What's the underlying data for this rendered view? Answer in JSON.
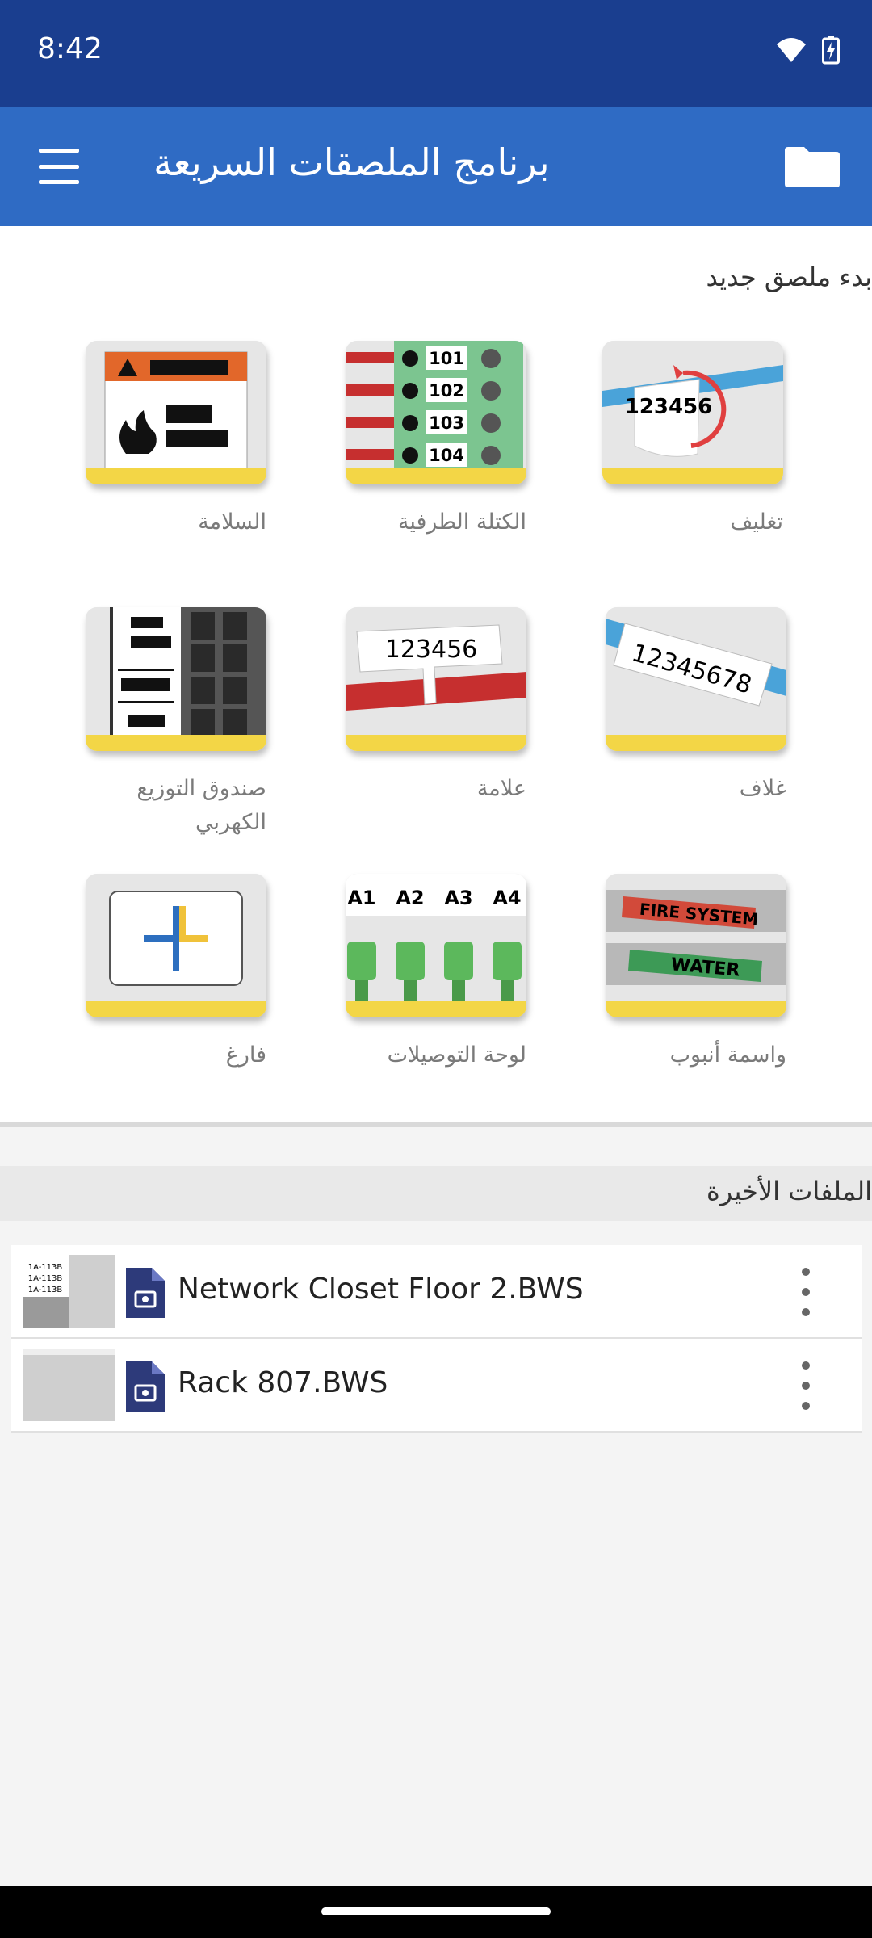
{
  "status_bar": {
    "time": "8:42"
  },
  "app_bar": {
    "title": "برنامج الملصقات السريعة"
  },
  "new_label": {
    "title": "بدء ملصق جديد",
    "tiles": [
      {
        "label": "تغليف",
        "icon": "wrap-label-icon"
      },
      {
        "label": "الكتلة الطرفية",
        "icon": "terminal-block-icon",
        "numbers": [
          "101",
          "102",
          "103",
          "104"
        ]
      },
      {
        "label": "السلامة",
        "icon": "safety-label-icon"
      },
      {
        "label": "غلاف",
        "icon": "sleeve-label-icon",
        "text": "12345678"
      },
      {
        "label": "علامة",
        "icon": "flag-label-icon",
        "text": "123456"
      },
      {
        "label": "صندوق التوزيع الكهربي",
        "icon": "distribution-panel-icon"
      },
      {
        "label": "واسمة أنبوب",
        "icon": "pipe-marker-icon",
        "texts": [
          "FIRE SYSTEM",
          "WATER"
        ]
      },
      {
        "label": "لوحة التوصيلات",
        "icon": "patch-panel-icon",
        "ports": [
          "A1",
          "A2",
          "A3",
          "A4"
        ]
      },
      {
        "label": "فارغ",
        "icon": "blank-label-icon"
      }
    ],
    "wrap_text": "123456"
  },
  "recent_files": {
    "title": "الملفات الأخيرة",
    "files": [
      {
        "name": "Network Closet Floor 2.BWS",
        "thumb_text": [
          "1A-113B",
          "1A-113B",
          "1A-113B"
        ]
      },
      {
        "name": "Rack 807.BWS"
      }
    ]
  },
  "colors": {
    "status_bar": "#1a3e8f",
    "app_bar": "#2f6bc4",
    "tile_stripe": "#f3d646"
  }
}
